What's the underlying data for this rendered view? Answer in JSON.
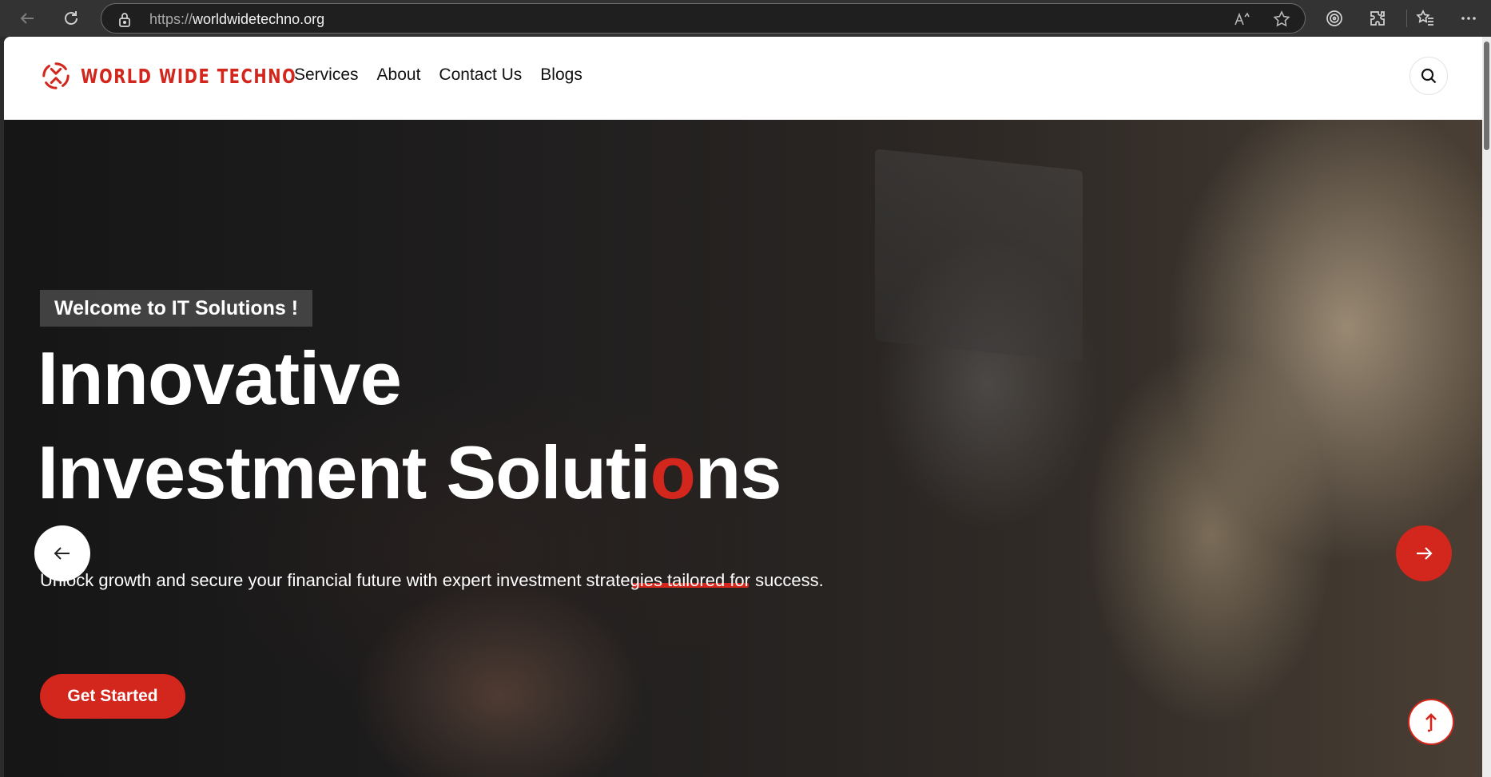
{
  "browser": {
    "url_protocol": "https://",
    "url_host": "worldwidetechno.org",
    "icons": [
      "back-icon",
      "refresh-icon",
      "lock-icon",
      "read-aloud-icon",
      "favorite-star-icon",
      "browser-essentials-icon",
      "extensions-icon",
      "favorites-icon",
      "more-icon"
    ]
  },
  "site": {
    "brand_name": "WORLD WIDE TECHNO",
    "brand_color": "#d3261c",
    "nav": [
      {
        "label": "Services"
      },
      {
        "label": "About"
      },
      {
        "label": "Contact Us"
      },
      {
        "label": "Blogs"
      }
    ],
    "search_icon": "search-icon"
  },
  "hero": {
    "badge": "Welcome to IT Solutions !",
    "headline_line1": "Innovative",
    "headline_line2_pre": "Investment Soluti",
    "headline_line2_accent": "o",
    "headline_line2_post": "ns",
    "subtitle": "Unlock growth and secure your financial future with expert investment strategies tailored for success.",
    "cta_label": "Get Started",
    "prev_icon": "arrow-left-icon",
    "next_icon": "arrow-right-icon",
    "scroll_top_icon": "arrow-up-icon"
  }
}
